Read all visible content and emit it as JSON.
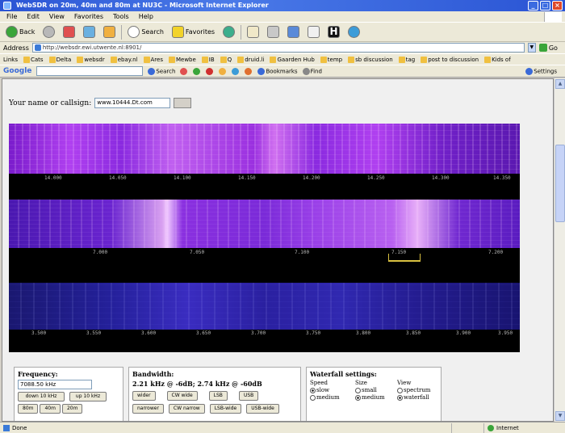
{
  "window": {
    "title": "WebSDR on 20m, 40m and 80m at NU3C - Microsoft Internet Explorer"
  },
  "menu": [
    "File",
    "Edit",
    "View",
    "Favorites",
    "Tools",
    "Help"
  ],
  "toolbar": {
    "back_label": "Back",
    "search_label": "Search",
    "favorites_label": "Favorites"
  },
  "address": {
    "label": "Address",
    "url": "http://websdr.ewi.utwente.nl:8901/",
    "go_label": "Go"
  },
  "links": {
    "label": "Links",
    "items": [
      "Cats",
      "Delta",
      "websdr",
      "ebay.nl",
      "Ares",
      "Mewbe",
      "IB",
      "Q",
      "druid.li",
      "Gaarden Hub",
      "temp",
      "sb discussion",
      "tag",
      "post to discussion",
      "Kids of"
    ]
  },
  "googlebar": {
    "logo": "Google",
    "search_label": "Search",
    "bookmarks_label": "Bookmarks",
    "find_label": "Find",
    "settings_label": "Settings"
  },
  "page": {
    "name_label": "Your name or callsign:",
    "name_value": "www.10444.Dt.com"
  },
  "waterfalls": [
    {
      "band": "20m",
      "ticks": [
        "14.000",
        "14.050",
        "14.100",
        "14.150",
        "14.200",
        "14.250",
        "14.300",
        "14.350"
      ]
    },
    {
      "band": "40m",
      "ticks": [
        "7.000",
        "7.050",
        "7.100",
        "7.150",
        "7.200",
        "7.250"
      ]
    },
    {
      "band": "80m",
      "ticks": [
        "3.500",
        "3.550",
        "3.600",
        "3.650",
        "3.700",
        "3.750",
        "3.800",
        "3.850",
        "3.900",
        "3.950"
      ]
    }
  ],
  "frequency": {
    "title": "Frequency:",
    "value": "7088.50 kHz",
    "down_label": "down 10 kHz",
    "up_label": "up 10 kHz",
    "band_buttons": [
      "80m",
      "40m",
      "20m"
    ]
  },
  "bandwidth": {
    "title": "Bandwidth:",
    "value_text": "2.21 kHz @ -6dB; 2.74 kHz @ -60dB",
    "row1": [
      "wider",
      "CW wide",
      "LSB",
      "USB"
    ],
    "row2": [
      "narrower",
      "CW narrow",
      "LSB-wide",
      "USB-wide"
    ]
  },
  "waterfall_settings": {
    "title": "Waterfall settings:",
    "speed_label": "Speed",
    "size_label": "Size",
    "view_label": "View",
    "speed_options": [
      "slow",
      "medium"
    ],
    "size_options": [
      "small",
      "medium"
    ],
    "view_options": [
      "spectrum",
      "waterfall"
    ]
  },
  "status": {
    "left": "Done",
    "zone": "Internet"
  }
}
